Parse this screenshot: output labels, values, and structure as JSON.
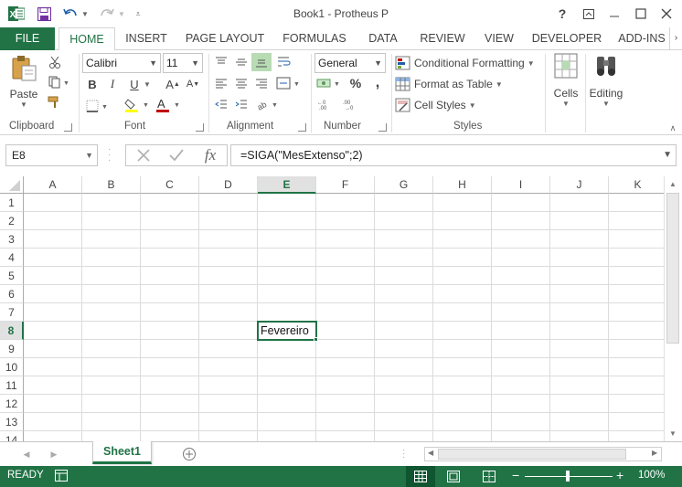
{
  "titlebar": {
    "title": "Book1 - Protheus P",
    "help": "?",
    "icons": [
      "excel-logo",
      "save-icon",
      "undo-icon",
      "redo-icon",
      "customize-qat-icon",
      "ribbon-display-icon",
      "minimize-icon",
      "restore-icon",
      "close-icon"
    ]
  },
  "tabs": {
    "file": "FILE",
    "home": "HOME",
    "insert": "INSERT",
    "page_layout": "PAGE LAYOUT",
    "formulas": "FORMULAS",
    "data": "DATA",
    "review": "REVIEW",
    "view": "VIEW",
    "developer": "DEVELOPER",
    "addins": "ADD-INS"
  },
  "ribbon": {
    "clipboard": {
      "paste": "Paste",
      "label": "Clipboard"
    },
    "font": {
      "name": "Calibri",
      "size": "11",
      "label": "Font",
      "bold": "B",
      "italic": "I",
      "underline": "U",
      "grow": "A",
      "shrink": "A",
      "font_color_glyph": "A"
    },
    "alignment": {
      "label": "Alignment"
    },
    "number": {
      "format": "General",
      "percent": "%",
      "comma": ",",
      "label": "Number"
    },
    "styles": {
      "conditional": "Conditional Formatting",
      "format_table": "Format as Table",
      "cell_styles": "Cell Styles",
      "label": "Styles"
    },
    "cells": {
      "label": "Cells"
    },
    "editing": {
      "label": "Editing"
    }
  },
  "formula_bar": {
    "name_box": "E8",
    "fx": "fx",
    "formula": "=SIGA(\"MesExtenso\";2)"
  },
  "grid": {
    "columns": [
      "A",
      "B",
      "C",
      "D",
      "E",
      "F",
      "G",
      "H",
      "I",
      "J",
      "K"
    ],
    "rows": [
      "1",
      "2",
      "3",
      "4",
      "5",
      "6",
      "7",
      "8",
      "9",
      "10",
      "11",
      "12",
      "13",
      "14"
    ],
    "active_column": "E",
    "active_row": "8",
    "cell_E8": "Fevereiro"
  },
  "sheets": {
    "active": "Sheet1"
  },
  "status": {
    "mode": "READY",
    "zoom": "100%",
    "zoom_minus": "−",
    "zoom_plus": "+"
  },
  "colors": {
    "accent": "#217346",
    "font_color_bar": "#c00000",
    "highlight_bar": "#ffff00"
  }
}
